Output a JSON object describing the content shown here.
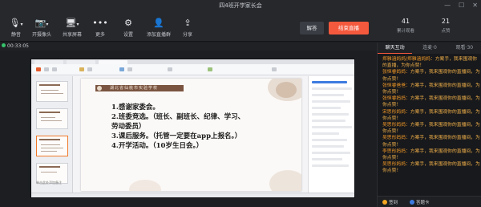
{
  "window": {
    "title": "四4班开学家长会",
    "controls": [
      "—",
      "☐",
      "✕"
    ]
  },
  "toolbar": {
    "items": [
      {
        "label": "静音",
        "icon": "🎙",
        "arrow": "▾"
      },
      {
        "label": "开摄像头",
        "icon": "📷",
        "arrow": "▾"
      },
      {
        "label": "共享屏幕",
        "icon": "🖥",
        "arrow": "▾"
      },
      {
        "label": "更多",
        "icon": "•••"
      },
      {
        "label": "设置",
        "icon": "⚙"
      },
      {
        "label": "添加直播群",
        "icon": "👤"
      },
      {
        "label": "分享",
        "icon": "⇪"
      }
    ],
    "speak_label": "解答",
    "end_label": "结束直播",
    "stats": [
      {
        "num": "41",
        "cap": "累计观看"
      },
      {
        "num": "21",
        "cap": "点赞"
      }
    ]
  },
  "status": {
    "elapsed": "00:33:05"
  },
  "slide": {
    "banner_text": "湖北省仙桃市实验学校",
    "lines": [
      "1.感谢家委会。",
      "2.班委竞选。（班长、副班长、纪律、学习、",
      "劳动委员）",
      "3.课后服务。（托管一定要在app上报名。）",
      "4.开学活动。（10岁生日会。）"
    ]
  },
  "thumbs_caption": "单击此处添加备注",
  "sidebar": {
    "tabs": [
      "聊天互动",
      "连麦·0",
      "观看·30"
    ],
    "messages": [
      {
        "who": "郑雅涵妈妈/郑雅涵妈妈：",
        "text": "方案手，我来围观你的直播，为你点赞！"
      },
      {
        "who": "张恒睿妈妈：",
        "text": "方案手，我来围观你的直播间，为你点赞！"
      },
      {
        "who": "张恒睿爸爸：",
        "text": "方案手，我来围观你的直播间，为你点赞！"
      },
      {
        "who": "张恒睿妈妈：",
        "text": "方案手，我来围观你的直播间，为你点赞！"
      },
      {
        "who": "宋思彤妈妈：",
        "text": "方案手，我来围观你的直播间，为你点赞！"
      },
      {
        "who": "吴思彤妈妈：",
        "text": "方案手，我来围观你的直播间，为你点赞！"
      },
      {
        "who": "吴思彤妈妈：",
        "text": "方案手，我来围观你的直播间，为你点赞！"
      },
      {
        "who": "李思彤妈妈：",
        "text": "方案手，我来围观你的直播间，为你点赞！"
      },
      {
        "who": "吴思彤妈妈：",
        "text": "方案手，我来围观你的直播间，为你点赞！"
      }
    ],
    "footer": {
      "sign_in": "签到",
      "answer_card": "答题卡"
    }
  }
}
